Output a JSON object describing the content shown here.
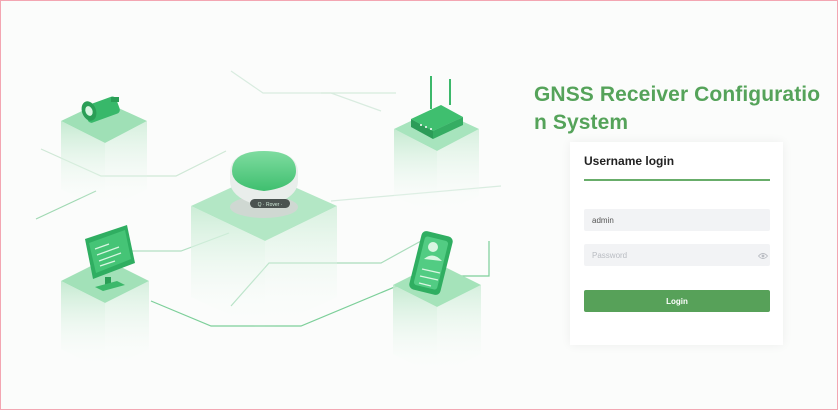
{
  "page": {
    "title": "GNSS Receiver Configuratio\nn System"
  },
  "login_card": {
    "heading": "Username login",
    "username": {
      "value": "admin",
      "placeholder": ""
    },
    "password": {
      "value": "",
      "placeholder": "Password"
    },
    "button_label": "Login"
  },
  "illustration": {
    "receiver_label": "Q-Rover",
    "icons": [
      "camera-sensor-icon",
      "router-icon",
      "gnss-receiver-icon",
      "monitor-icon",
      "phone-contact-icon"
    ]
  },
  "colors": {
    "brand_green": "#55a35a",
    "button_green": "#57a159",
    "border_pink": "#f3a6b2"
  }
}
